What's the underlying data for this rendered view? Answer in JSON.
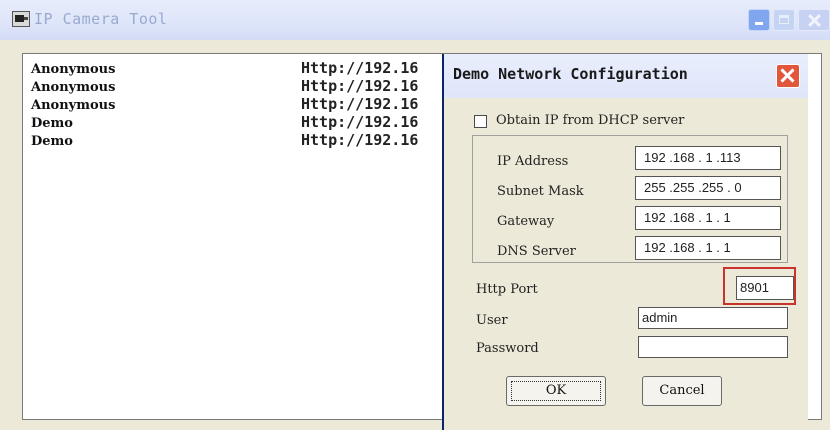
{
  "app": {
    "title": "IP Camera Tool"
  },
  "devices": [
    {
      "name": "Anonymous",
      "url": "Http://192.16"
    },
    {
      "name": "Anonymous",
      "url": "Http://192.16"
    },
    {
      "name": "Anonymous",
      "url": "Http://192.16"
    },
    {
      "name": "Demo",
      "url": "Http://192.16"
    },
    {
      "name": "Demo",
      "url": "Http://192.16"
    }
  ],
  "dialog": {
    "title": "Demo  Network Configuration",
    "dhcp_label": "Obtain IP from DHCP server",
    "dhcp_checked": false,
    "ip_address_label": "IP Address",
    "ip_address": "192 .168 . 1  .113",
    "subnet_mask_label": "Subnet Mask",
    "subnet_mask": "255 .255 .255 . 0",
    "gateway_label": "Gateway",
    "gateway": "192 .168 . 1  . 1",
    "dns_label": "DNS Server",
    "dns": "192 .168 . 1  . 1",
    "http_port_label": "Http Port",
    "http_port": "8901",
    "user_label": "User",
    "user": "admin",
    "password_label": "Password",
    "password": "",
    "ok_label": "OK",
    "cancel_label": "Cancel"
  },
  "colors": {
    "highlight": "#c8342c",
    "dialog_close": "#e2563c"
  }
}
